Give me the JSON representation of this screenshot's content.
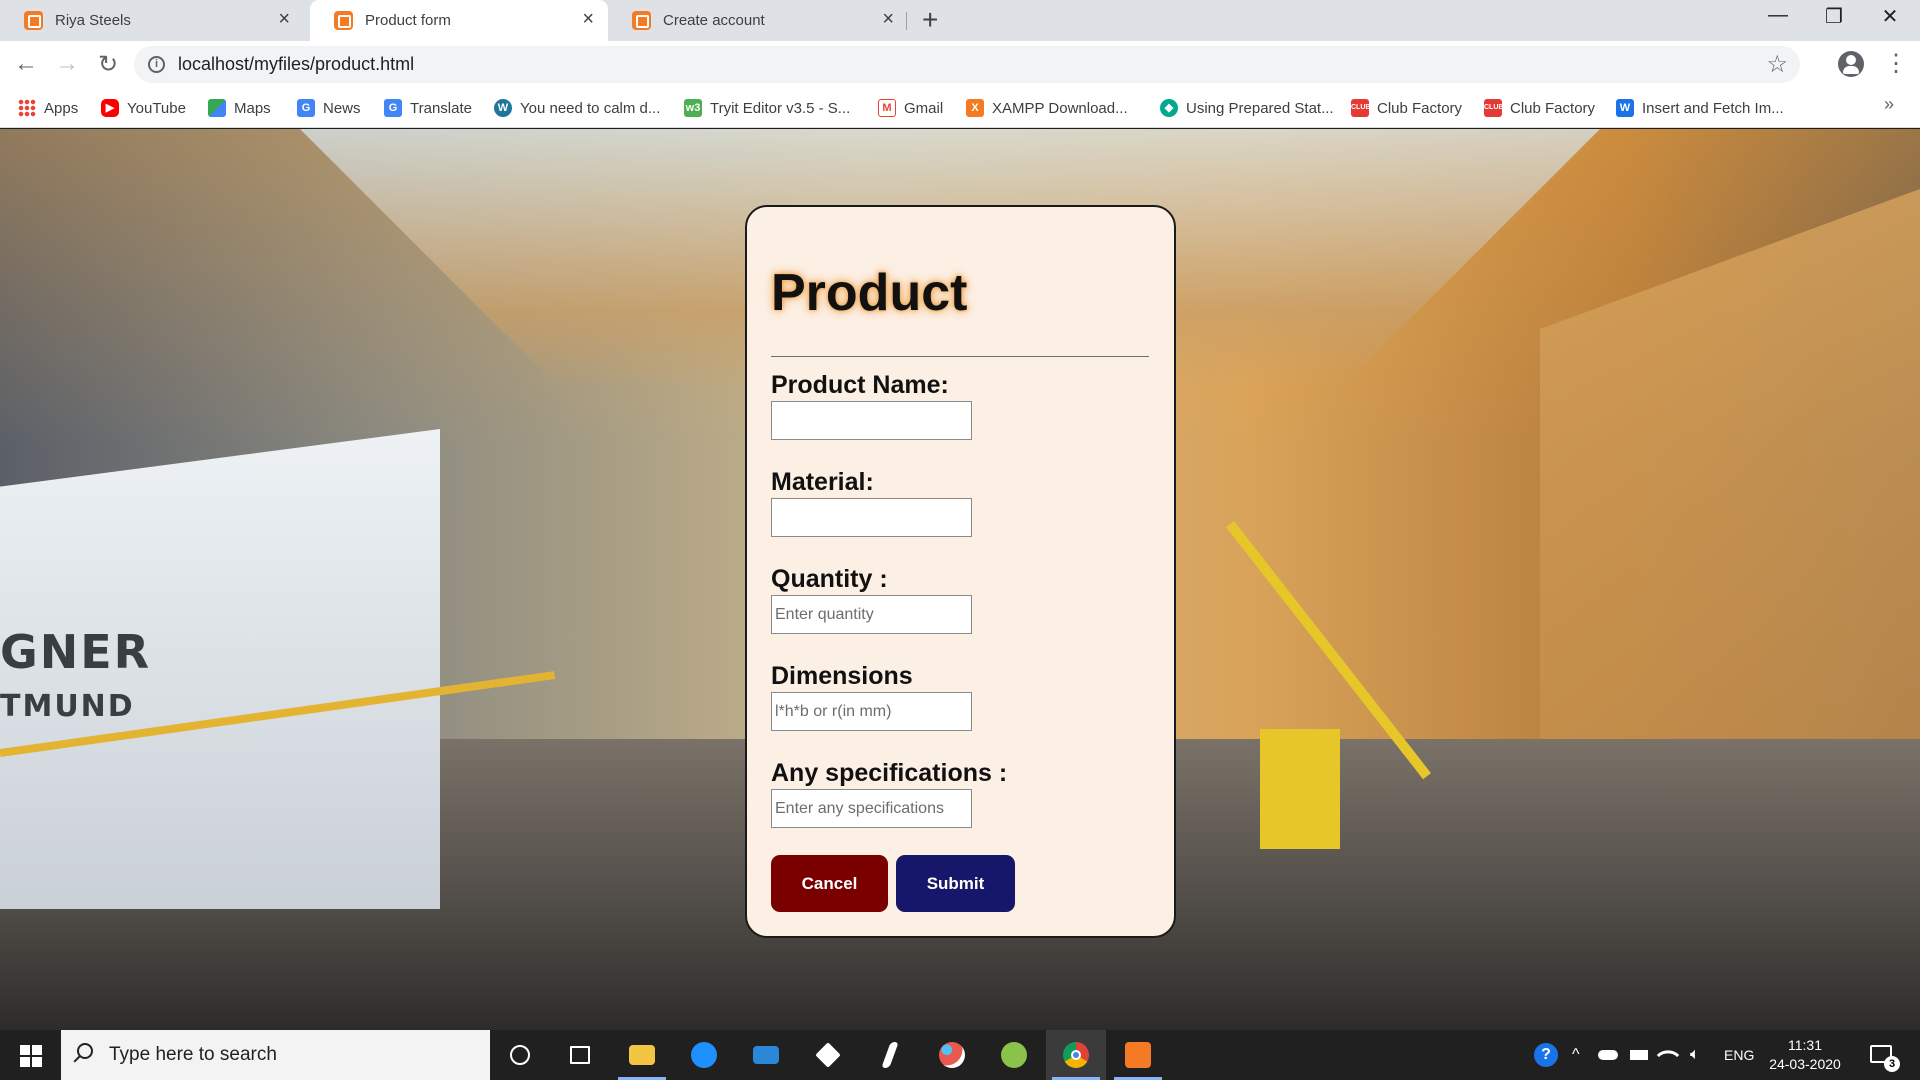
{
  "browser": {
    "tabs": [
      {
        "title": "Riya Steels",
        "active": false
      },
      {
        "title": "Product form",
        "active": true
      },
      {
        "title": "Create account",
        "active": false
      }
    ],
    "close_glyph": "×",
    "new_tab_glyph": "+",
    "window_controls": {
      "minimize": "—",
      "maximize": "❐",
      "close": "✕"
    },
    "url": "localhost/myfiles/product.html",
    "nav": {
      "back": "←",
      "forward": "→",
      "reload": "↻"
    },
    "star_glyph": "☆",
    "menu_glyph": "⋮",
    "info_glyph": "i"
  },
  "bookmarks": {
    "items": [
      {
        "label": "Apps",
        "icon": "apps-grid-icon",
        "color": "#4285f4"
      },
      {
        "label": "YouTube",
        "icon": "youtube-icon",
        "color": "#ff0000"
      },
      {
        "label": "Maps",
        "icon": "maps-icon",
        "color": "#34a853"
      },
      {
        "label": "News",
        "icon": "google-news-icon",
        "color": "#4285f4"
      },
      {
        "label": "Translate",
        "icon": "translate-icon",
        "color": "#4285f4"
      },
      {
        "label": "You need to calm d...",
        "icon": "wordpress-icon",
        "color": "#21759b"
      },
      {
        "label": "Tryit Editor v3.5 - S...",
        "icon": "w3schools-icon",
        "color": "#4caf50"
      },
      {
        "label": "Gmail",
        "icon": "gmail-icon",
        "color": "#ea4335"
      },
      {
        "label": "XAMPP Download...",
        "icon": "xampp-icon",
        "color": "#f47b23"
      },
      {
        "label": "Using Prepared Stat...",
        "icon": "prepared-stat-icon",
        "color": "#00a88f"
      },
      {
        "label": "Club Factory",
        "icon": "club-factory-icon",
        "color": "#e53935"
      },
      {
        "label": "Club Factory",
        "icon": "club-factory-icon",
        "color": "#e53935"
      },
      {
        "label": "Insert and Fetch Im...",
        "icon": "w-icon",
        "color": "#1a73e8"
      }
    ],
    "more_glyph": "»"
  },
  "background_text": {
    "line1": "GNER",
    "line2": "TMUND"
  },
  "form": {
    "title": "Product",
    "fields": [
      {
        "label": "Product Name:",
        "value": "",
        "placeholder": ""
      },
      {
        "label": "Material:",
        "value": "",
        "placeholder": ""
      },
      {
        "label": "Quantity :",
        "value": "",
        "placeholder": "Enter quantity"
      },
      {
        "label": "Dimensions",
        "value": "",
        "placeholder": "l*h*b or r(in mm)"
      },
      {
        "label": "Any specifications :",
        "value": "",
        "placeholder": "Enter any specifications"
      }
    ],
    "buttons": {
      "cancel": "Cancel",
      "submit": "Submit"
    },
    "colors": {
      "card": "#fcefe4",
      "cancel": "#7a0000",
      "submit": "#16166a",
      "title_glow": "#f0a24a"
    }
  },
  "taskbar": {
    "search_placeholder": "Type here to search",
    "apps": [
      {
        "name": "cortana-icon",
        "color": "#ffffff"
      },
      {
        "name": "task-view-icon",
        "color": "#ffffff"
      },
      {
        "name": "file-explorer-icon",
        "color": "#f4c542"
      },
      {
        "name": "edge-icon",
        "color": "#1e90ff"
      },
      {
        "name": "mail-icon",
        "color": "#2b88d8"
      },
      {
        "name": "dropbox-icon",
        "color": "#ffffff"
      },
      {
        "name": "winamp-icon",
        "color": "#ffffff"
      },
      {
        "name": "paint-icon",
        "color": "#e85a4f"
      },
      {
        "name": "qgis-icon",
        "color": "#8bc34a"
      },
      {
        "name": "chrome-icon",
        "color": "#db4437"
      },
      {
        "name": "xampp-icon",
        "color": "#f47b23"
      }
    ],
    "language": "ENG",
    "time": "11:31",
    "date": "24-03-2020",
    "notifications": "3",
    "help_glyph": "?",
    "chevron_glyph": "^"
  }
}
